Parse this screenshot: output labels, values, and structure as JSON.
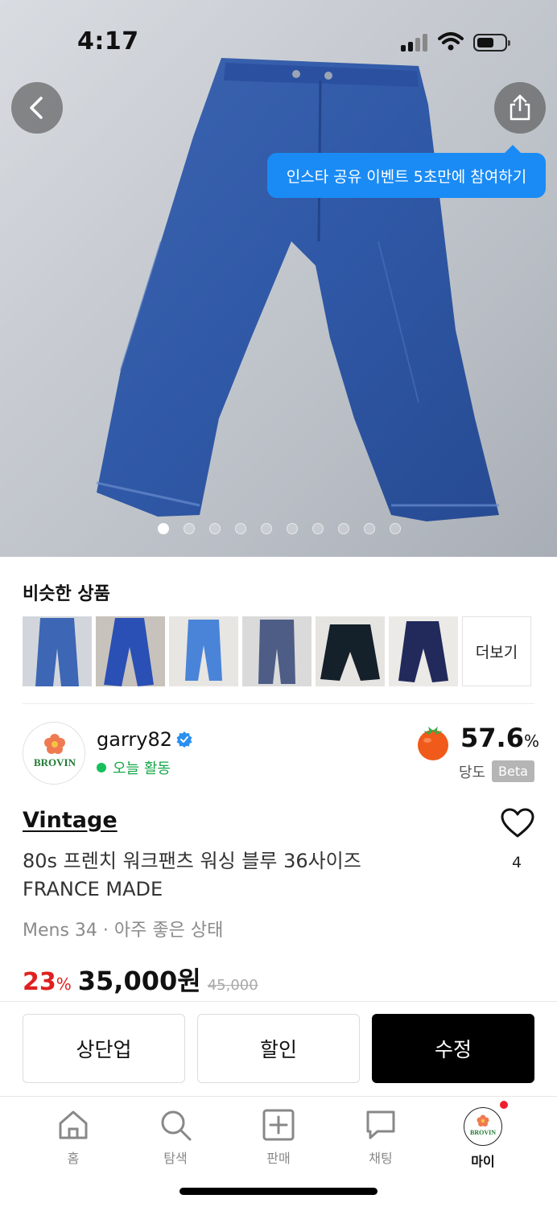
{
  "status_bar": {
    "time": "4:17"
  },
  "hero": {
    "tooltip": "인스타 공유 이벤트 5초만에 참여하기",
    "page_count": 10,
    "active_index": 0
  },
  "similar": {
    "title": "비슷한 상품",
    "more_label": "더보기"
  },
  "seller": {
    "name": "garry82",
    "logo_text": "BROVIN",
    "activity": "오늘 활동",
    "sweetness_value": "57.6",
    "sweetness_unit": "%",
    "sweetness_label": "당도",
    "beta": "Beta"
  },
  "product": {
    "brand": "Vintage",
    "title_line1": "80s 프렌치 워크팬츠 워싱 블루 36사이즈",
    "title_line2": "FRANCE MADE",
    "subinfo": "Mens 34 · 아주 좋은 상태",
    "like_count": "4",
    "discount_value": "23",
    "discount_unit": "%",
    "price": "35,000원",
    "original_price": "45,000"
  },
  "actions": {
    "bump": "상단업",
    "discount": "할인",
    "edit": "수정"
  },
  "tabbar": {
    "home": "홈",
    "search": "탐색",
    "sell": "판매",
    "chat": "채팅",
    "my": "마이",
    "logo_text": "BROVIN"
  },
  "colors": {
    "accent_blue": "#1a8bf5",
    "discount_red": "#e02020",
    "active_green": "#17c05a",
    "primary_black": "#000000"
  }
}
